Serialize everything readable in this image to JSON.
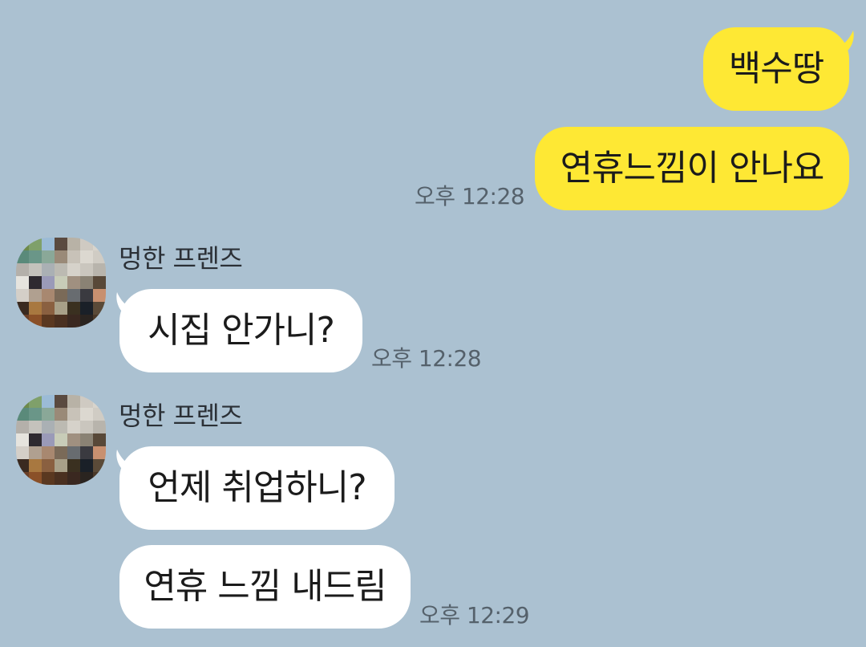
{
  "conversation": {
    "sent_group": {
      "messages": [
        {
          "text": "백수땅"
        },
        {
          "text": "연휴느낌이 안나요"
        }
      ],
      "time": "오후 12:28"
    },
    "received_groups": [
      {
        "sender": "멍한 프렌즈",
        "messages": [
          {
            "text": "시집 안가니?"
          }
        ],
        "time": "오후 12:28"
      },
      {
        "sender": "멍한 프렌즈",
        "messages": [
          {
            "text": "언제 취업하니?"
          },
          {
            "text": "연휴 느낌 내드림"
          }
        ],
        "time": "오후 12:29"
      }
    ]
  },
  "colors": {
    "background": "#abc1d1",
    "my_bubble": "#fee834",
    "their_bubble": "#ffffff",
    "timestamp": "#55616b",
    "sender_name": "#2b3036"
  },
  "icons": {
    "avatar": "pixelated-profile-avatar-icon"
  }
}
